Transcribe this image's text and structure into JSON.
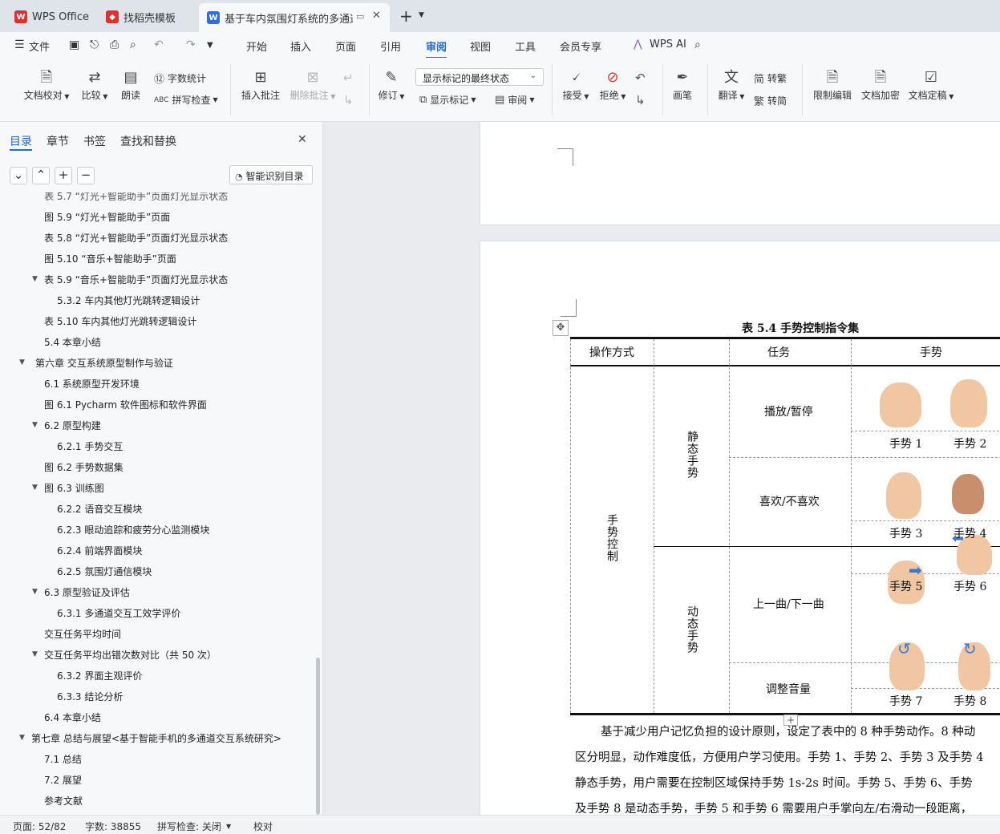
{
  "tabs": [
    {
      "label": "WPS Office"
    },
    {
      "label": "找稻壳模板"
    },
    {
      "label": "基于车内氛围灯系统的多通道..."
    }
  ],
  "menu": {
    "file": "文件",
    "items": [
      "开始",
      "插入",
      "页面",
      "引用",
      "审阅",
      "视图",
      "工具",
      "会员专享"
    ],
    "ai": "WPS AI"
  },
  "ribbon": {
    "doc_check": "文档校对",
    "compare": "比较",
    "read": "朗读",
    "word_count": "字数统计",
    "spell_check": "拼写检查",
    "insert_comment": "插入批注",
    "delete_comment": "删除批注",
    "track": "修订",
    "markup_select": "显示标记的最终状态",
    "show_markup": "显示标记",
    "review": "审阅",
    "accept": "接受",
    "reject": "拒绝",
    "pen": "画笔",
    "translate": "翻译",
    "to_traditional": "转繁",
    "to_simplified": "转简",
    "restrict_edit": "限制编辑",
    "encrypt": "文档加密",
    "finalize": "文档定稿"
  },
  "panel": {
    "tabs": [
      "目录",
      "章节",
      "书签",
      "查找和替换"
    ],
    "smart_toc": "智能识别目录",
    "partial_item": "表 5.7 “灯光+智能助手”页面灯光显示状态",
    "items": [
      {
        "label": "图 5.9 “灯光+智能助手”页面",
        "indent": 1,
        "toggle": ""
      },
      {
        "label": "表 5.8 “灯光+智能助手”页面灯光显示状态",
        "indent": 1,
        "toggle": ""
      },
      {
        "label": "图 5.10 “音乐+智能助手”页面",
        "indent": 1,
        "toggle": ""
      },
      {
        "label": "表 5.9 “音乐+智能助手”页面灯光显示状态",
        "indent": 1,
        "toggle": "▼"
      },
      {
        "label": "5.3.2 车内其他灯光跳转逻辑设计",
        "indent": 2,
        "toggle": ""
      },
      {
        "label": "表 5.10 车内其他灯光跳转逻辑设计",
        "indent": 1,
        "toggle": ""
      },
      {
        "label": "5.4 本章小结",
        "indent": 1,
        "toggle": ""
      },
      {
        "label": "第六章 交互系统原型制作与验证",
        "indent": 0,
        "toggle": "▼"
      },
      {
        "label": "6.1 系统原型开发环境",
        "indent": 1,
        "toggle": ""
      },
      {
        "label": "图 6.1 Pycharm 软件图标和软件界面",
        "indent": 1,
        "toggle": ""
      },
      {
        "label": "6.2 原型构建",
        "indent": 1,
        "toggle": "▼"
      },
      {
        "label": "6.2.1 手势交互",
        "indent": 2,
        "toggle": ""
      },
      {
        "label": "图 6.2 手势数据集",
        "indent": 1,
        "toggle": ""
      },
      {
        "label": "图 6.3 训练图",
        "indent": 1,
        "toggle": "▼"
      },
      {
        "label": "6.2.2 语音交互模块",
        "indent": 2,
        "toggle": ""
      },
      {
        "label": "6.2.3 眼动追踪和疲劳分心监测模块",
        "indent": 2,
        "toggle": ""
      },
      {
        "label": "6.2.4 前端界面模块",
        "indent": 2,
        "toggle": ""
      },
      {
        "label": "6.2.5 氛围灯通信模块",
        "indent": 2,
        "toggle": ""
      },
      {
        "label": "6.3 原型验证及评估",
        "indent": 1,
        "toggle": "▼"
      },
      {
        "label": "6.3.1 多通道交互工效学评价",
        "indent": 2,
        "toggle": ""
      },
      {
        "label": "交互任务平均时间",
        "indent": 1,
        "toggle": ""
      },
      {
        "label": "交互任务平均出错次数对比（共 50 次）",
        "indent": 1,
        "toggle": "▼"
      },
      {
        "label": "6.3.2 界面主观评价",
        "indent": 2,
        "toggle": ""
      },
      {
        "label": "6.3.3 结论分析",
        "indent": 2,
        "toggle": ""
      },
      {
        "label": "6.4 本章小结",
        "indent": 1,
        "toggle": ""
      },
      {
        "label": "第七章 总结与展望<基于智能手机的多通道交互系统研究>",
        "indent": 0,
        "toggle": "▼"
      },
      {
        "label": "7.1 总结",
        "indent": 1,
        "toggle": ""
      },
      {
        "label": "7.2 展望",
        "indent": 1,
        "toggle": ""
      },
      {
        "label": "参考文献",
        "indent": 1,
        "toggle": ""
      }
    ]
  },
  "doc": {
    "table_caption": "表 5.4  手势控制指令集",
    "headers": [
      "操作方式",
      "任务",
      "手势"
    ],
    "control": "手势控制",
    "static": "静态手势",
    "dynamic": "动态手势",
    "tasks": [
      "播放/暂停",
      "喜欢/不喜欢",
      "上一曲/下一曲",
      "调整音量"
    ],
    "gestures": [
      "手势 1",
      "手势 2",
      "手势 3",
      "手势 4",
      "手势 5",
      "手势 6",
      "手势 7",
      "手势 8"
    ],
    "body_lines": [
      "基于减少用户记忆负担的设计原则，设定了表中的 8 种手势动作。8 种动",
      "区分明显，动作难度低，方便用户学习使用。手势 1、手势 2、手势 3 及手势 4",
      "静态手势，用户需要在控制区域保持手势 1s-2s 时间。手势 5、手势 6、手势",
      "及手势 8 是动态手势，手势 5 和手势 6 需要用户手掌向左/右滑动一段距离，"
    ]
  },
  "status": {
    "page": "页面: 52/82",
    "words": "字数: 38855",
    "spell": "拼写检查: 关闭",
    "proof": "校对"
  }
}
